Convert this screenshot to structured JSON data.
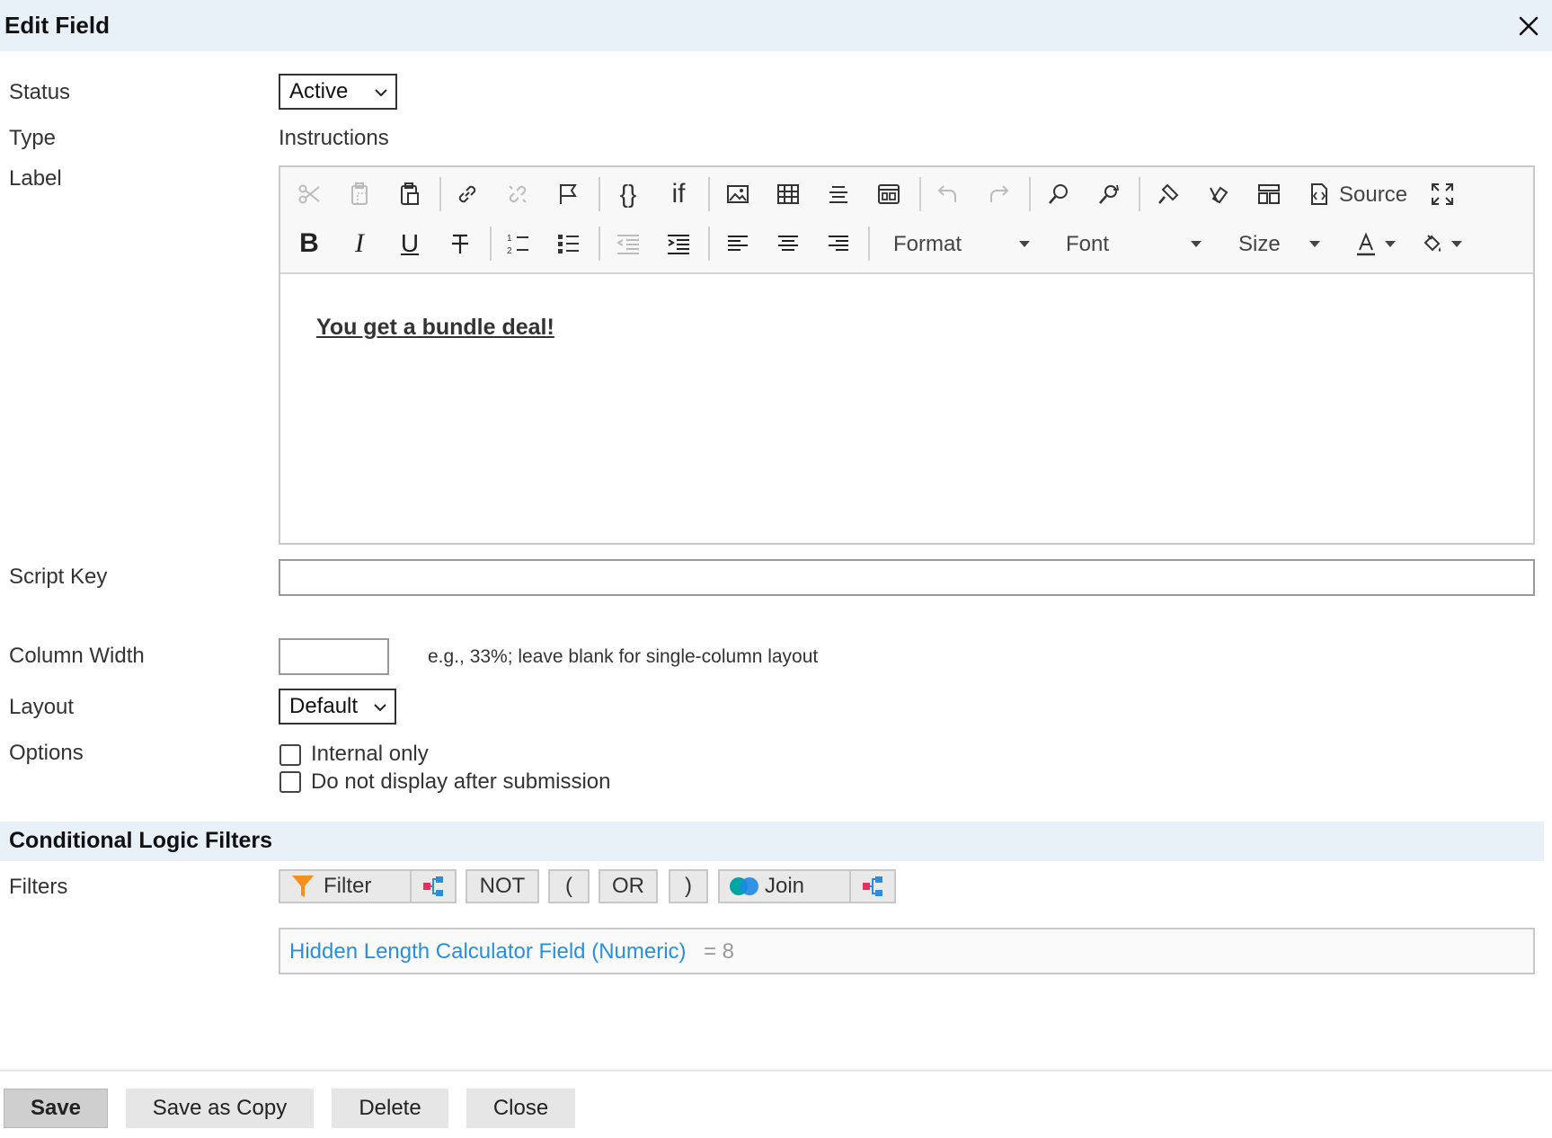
{
  "dialog": {
    "title": "Edit Field"
  },
  "fields": {
    "status_label": "Status",
    "status_value": "Active",
    "type_label": "Type",
    "type_value": "Instructions",
    "label_label": "Label",
    "script_key_label": "Script Key",
    "script_key_value": "",
    "column_width_label": "Column Width",
    "column_width_value": "",
    "column_width_hint": "e.g., 33%; leave blank for single-column layout",
    "layout_label": "Layout",
    "layout_value": "Default",
    "options_label": "Options",
    "options": [
      {
        "label": "Internal only",
        "checked": false
      },
      {
        "label": "Do not display after submission",
        "checked": false
      }
    ]
  },
  "editor": {
    "toolbar": {
      "source_label": "Source",
      "format_label": "Format",
      "font_label": "Font",
      "size_label": "Size",
      "if_label": "if",
      "braces_label": "{}"
    },
    "content": "You get a bundle deal!"
  },
  "conditional": {
    "section_title": "Conditional Logic Filters",
    "filters_label": "Filters",
    "buttons": {
      "filter": "Filter",
      "not": "NOT",
      "open_paren": "(",
      "or": "OR",
      "close_paren": ")",
      "join": "Join"
    },
    "rule": {
      "field": "Hidden Length Calculator Field (Numeric)",
      "condition": "= 8"
    }
  },
  "footer": {
    "save": "Save",
    "save_copy": "Save as Copy",
    "delete": "Delete",
    "close": "Close"
  },
  "colors": {
    "header_bg": "#e8f0f8",
    "link": "#2a8fdb",
    "filter_icon": "#f5901e",
    "join_blue": "#1e88e5",
    "join_teal": "#00a6a6",
    "hierarchy_red": "#e83060",
    "hierarchy_blue": "#2a8fdb"
  }
}
